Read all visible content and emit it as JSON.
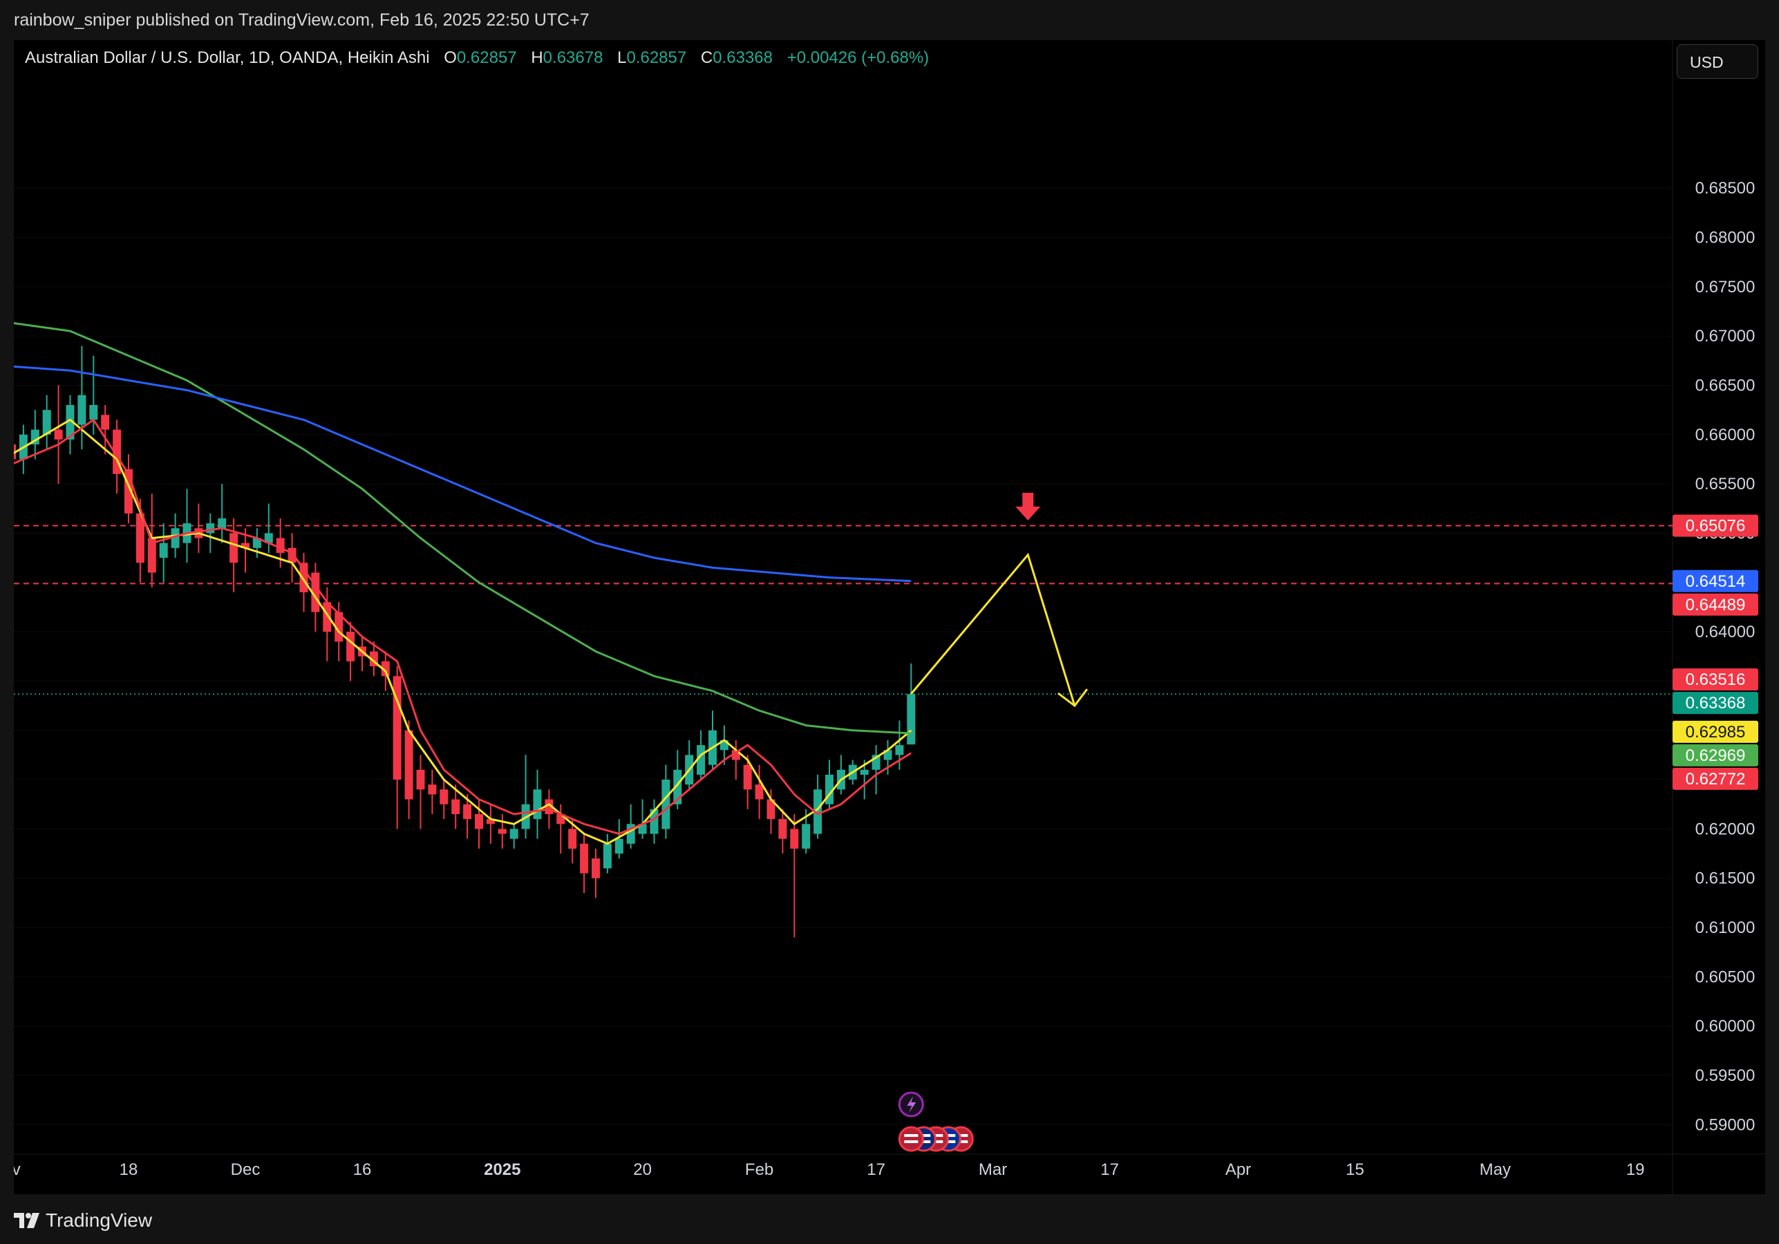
{
  "header": {
    "published_text": "rainbow_sniper published on TradingView.com, Feb 16, 2025 22:50 UTC+7"
  },
  "legend": {
    "symbol": "Australian Dollar / U.S. Dollar, 1D, OANDA, Heikin Ashi",
    "o_label": "O",
    "o_value": "0.62857",
    "h_label": "H",
    "h_value": "0.63678",
    "l_label": "L",
    "l_value": "0.62857",
    "c_label": "C",
    "c_value": "0.63368",
    "change": "+0.00426 (+0.68%)"
  },
  "currency_button": "USD",
  "footer": {
    "brand": "TradingView"
  },
  "colors": {
    "background": "#000000",
    "up": "#22ab94",
    "down": "#f23645",
    "ema_fast": "#f7e52b",
    "ema_mid": "#f23645",
    "ma_green": "#4caf50",
    "ma_blue": "#2962ff",
    "projection": "#f7e52b",
    "level_line": "#f23645",
    "current_line": "#22ab94"
  },
  "chart_data": {
    "type": "candlestick",
    "style": "Heikin Ashi",
    "ylim": [
      0.5875,
      0.6895
    ],
    "y_ticks": [
      "0.68500",
      "0.68000",
      "0.67500",
      "0.67000",
      "0.66500",
      "0.66000",
      "0.65500",
      "0.65000",
      "0.64500",
      "0.64000",
      "0.63500",
      "0.63000",
      "0.62500",
      "0.62000",
      "0.61500",
      "0.61000",
      "0.60500",
      "0.60000",
      "0.59500",
      "0.59000"
    ],
    "x_ticks": [
      {
        "label": "ov",
        "bold": false,
        "bar": 0
      },
      {
        "label": "18",
        "bold": false,
        "bar": 10
      },
      {
        "label": "Dec",
        "bold": false,
        "bar": 20
      },
      {
        "label": "16",
        "bold": false,
        "bar": 30
      },
      {
        "label": "2025",
        "bold": true,
        "bar": 42
      },
      {
        "label": "20",
        "bold": false,
        "bar": 54
      },
      {
        "label": "Feb",
        "bold": false,
        "bar": 64
      },
      {
        "label": "17",
        "bold": false,
        "bar": 74
      },
      {
        "label": "Mar",
        "bold": false,
        "bar": 84
      },
      {
        "label": "17",
        "bold": false,
        "bar": 94
      },
      {
        "label": "Apr",
        "bold": false,
        "bar": 105
      },
      {
        "label": "15",
        "bold": false,
        "bar": 115
      },
      {
        "label": "May",
        "bold": false,
        "bar": 127
      },
      {
        "label": "19",
        "bold": false,
        "bar": 139
      }
    ],
    "candles": [
      [
        0.659,
        0.6605,
        0.656,
        0.6575
      ],
      [
        0.6575,
        0.661,
        0.656,
        0.66
      ],
      [
        0.659,
        0.6625,
        0.6575,
        0.6605
      ],
      [
        0.66,
        0.664,
        0.6585,
        0.6625
      ],
      [
        0.6605,
        0.665,
        0.655,
        0.6595
      ],
      [
        0.6595,
        0.664,
        0.658,
        0.663
      ],
      [
        0.661,
        0.669,
        0.6585,
        0.664
      ],
      [
        0.6615,
        0.668,
        0.66,
        0.663
      ],
      [
        0.662,
        0.663,
        0.658,
        0.6605
      ],
      [
        0.6605,
        0.6615,
        0.654,
        0.656
      ],
      [
        0.6565,
        0.658,
        0.651,
        0.652
      ],
      [
        0.652,
        0.6535,
        0.645,
        0.647
      ],
      [
        0.6495,
        0.654,
        0.6445,
        0.646
      ],
      [
        0.6475,
        0.651,
        0.645,
        0.649
      ],
      [
        0.6485,
        0.652,
        0.6475,
        0.6505
      ],
      [
        0.649,
        0.6545,
        0.647,
        0.651
      ],
      [
        0.6505,
        0.653,
        0.648,
        0.6495
      ],
      [
        0.65,
        0.652,
        0.648,
        0.651
      ],
      [
        0.6505,
        0.655,
        0.649,
        0.6515
      ],
      [
        0.65,
        0.6515,
        0.644,
        0.647
      ],
      [
        0.649,
        0.6505,
        0.646,
        0.6485
      ],
      [
        0.6485,
        0.6505,
        0.6475,
        0.6495
      ],
      [
        0.649,
        0.653,
        0.648,
        0.65
      ],
      [
        0.6495,
        0.6515,
        0.6465,
        0.648
      ],
      [
        0.6485,
        0.65,
        0.645,
        0.647
      ],
      [
        0.647,
        0.648,
        0.642,
        0.644
      ],
      [
        0.646,
        0.647,
        0.64,
        0.642
      ],
      [
        0.643,
        0.6445,
        0.637,
        0.64
      ],
      [
        0.642,
        0.643,
        0.637,
        0.639
      ],
      [
        0.64,
        0.641,
        0.635,
        0.637
      ],
      [
        0.6385,
        0.6395,
        0.636,
        0.6375
      ],
      [
        0.638,
        0.639,
        0.6355,
        0.6365
      ],
      [
        0.637,
        0.638,
        0.634,
        0.6355
      ],
      [
        0.6355,
        0.6365,
        0.62,
        0.625
      ],
      [
        0.63,
        0.631,
        0.621,
        0.623
      ],
      [
        0.626,
        0.6275,
        0.62,
        0.624
      ],
      [
        0.6245,
        0.626,
        0.6215,
        0.6235
      ],
      [
        0.624,
        0.625,
        0.621,
        0.6225
      ],
      [
        0.623,
        0.6245,
        0.62,
        0.6215
      ],
      [
        0.6225,
        0.6235,
        0.619,
        0.621
      ],
      [
        0.6215,
        0.623,
        0.618,
        0.62
      ],
      [
        0.621,
        0.6225,
        0.6185,
        0.6205
      ],
      [
        0.62,
        0.6215,
        0.618,
        0.6195
      ],
      [
        0.619,
        0.6205,
        0.618,
        0.62
      ],
      [
        0.62,
        0.6275,
        0.619,
        0.6225
      ],
      [
        0.621,
        0.626,
        0.619,
        0.624
      ],
      [
        0.623,
        0.624,
        0.62,
        0.6215
      ],
      [
        0.6215,
        0.6225,
        0.6175,
        0.6205
      ],
      [
        0.62,
        0.621,
        0.6165,
        0.618
      ],
      [
        0.6185,
        0.6195,
        0.6135,
        0.6155
      ],
      [
        0.617,
        0.618,
        0.613,
        0.615
      ],
      [
        0.616,
        0.6195,
        0.6155,
        0.6185
      ],
      [
        0.6175,
        0.621,
        0.617,
        0.619
      ],
      [
        0.6185,
        0.6225,
        0.618,
        0.6205
      ],
      [
        0.6195,
        0.623,
        0.619,
        0.6205
      ],
      [
        0.6195,
        0.623,
        0.6185,
        0.622
      ],
      [
        0.62,
        0.6265,
        0.619,
        0.625
      ],
      [
        0.6225,
        0.628,
        0.622,
        0.626
      ],
      [
        0.6245,
        0.629,
        0.624,
        0.6275
      ],
      [
        0.6255,
        0.63,
        0.625,
        0.6285
      ],
      [
        0.6265,
        0.632,
        0.626,
        0.63
      ],
      [
        0.628,
        0.6305,
        0.6265,
        0.629
      ],
      [
        0.628,
        0.629,
        0.625,
        0.627
      ],
      [
        0.6265,
        0.6275,
        0.622,
        0.624
      ],
      [
        0.6245,
        0.6265,
        0.621,
        0.623
      ],
      [
        0.623,
        0.624,
        0.6195,
        0.621
      ],
      [
        0.621,
        0.622,
        0.6175,
        0.619
      ],
      [
        0.62,
        0.6215,
        0.609,
        0.618
      ],
      [
        0.618,
        0.622,
        0.6175,
        0.6205
      ],
      [
        0.6195,
        0.6255,
        0.619,
        0.624
      ],
      [
        0.6225,
        0.627,
        0.622,
        0.6255
      ],
      [
        0.624,
        0.6275,
        0.6235,
        0.626
      ],
      [
        0.625,
        0.627,
        0.6245,
        0.6265
      ],
      [
        0.6255,
        0.627,
        0.623,
        0.626
      ],
      [
        0.626,
        0.6285,
        0.6235,
        0.6275
      ],
      [
        0.627,
        0.629,
        0.6255,
        0.628
      ],
      [
        0.6275,
        0.631,
        0.626,
        0.6285
      ],
      [
        0.62857,
        0.63678,
        0.62857,
        0.63368
      ]
    ],
    "series": [
      {
        "color": "#f7e52b",
        "width": 3,
        "points": [
          [
            0,
            0.658
          ],
          [
            5,
            0.6615
          ],
          [
            9,
            0.6575
          ],
          [
            12,
            0.6495
          ],
          [
            16,
            0.65
          ],
          [
            20,
            0.6485
          ],
          [
            24,
            0.647
          ],
          [
            28,
            0.64
          ],
          [
            32,
            0.636
          ],
          [
            34,
            0.63
          ],
          [
            37,
            0.625
          ],
          [
            41,
            0.621
          ],
          [
            43,
            0.6205
          ],
          [
            46,
            0.6225
          ],
          [
            49,
            0.6195
          ],
          [
            51,
            0.6185
          ],
          [
            54,
            0.6205
          ],
          [
            57,
            0.6245
          ],
          [
            59,
            0.6275
          ],
          [
            61,
            0.629
          ],
          [
            63,
            0.627
          ],
          [
            65,
            0.623
          ],
          [
            67,
            0.6205
          ],
          [
            69,
            0.622
          ],
          [
            71,
            0.625
          ],
          [
            73,
            0.6265
          ],
          [
            75,
            0.628
          ],
          [
            77,
            0.63
          ]
        ]
      },
      {
        "color": "#f23645",
        "width": 3,
        "points": [
          [
            0,
            0.657
          ],
          [
            4,
            0.659
          ],
          [
            7,
            0.6615
          ],
          [
            10,
            0.656
          ],
          [
            12,
            0.649
          ],
          [
            15,
            0.65
          ],
          [
            18,
            0.6505
          ],
          [
            21,
            0.6495
          ],
          [
            24,
            0.648
          ],
          [
            27,
            0.643
          ],
          [
            30,
            0.6395
          ],
          [
            33,
            0.637
          ],
          [
            35,
            0.63
          ],
          [
            37,
            0.626
          ],
          [
            40,
            0.623
          ],
          [
            43,
            0.6215
          ],
          [
            46,
            0.622
          ],
          [
            49,
            0.6205
          ],
          [
            52,
            0.6195
          ],
          [
            55,
            0.621
          ],
          [
            58,
            0.624
          ],
          [
            61,
            0.627
          ],
          [
            63,
            0.6285
          ],
          [
            65,
            0.6265
          ],
          [
            67,
            0.6235
          ],
          [
            69,
            0.6215
          ],
          [
            71,
            0.6225
          ],
          [
            74,
            0.6255
          ],
          [
            77,
            0.6277
          ]
        ]
      },
      {
        "color": "#4caf50",
        "width": 3,
        "points": [
          [
            -1,
            0.6715
          ],
          [
            5,
            0.6705
          ],
          [
            10,
            0.668
          ],
          [
            15,
            0.6655
          ],
          [
            20,
            0.662
          ],
          [
            25,
            0.6585
          ],
          [
            30,
            0.6545
          ],
          [
            35,
            0.6495
          ],
          [
            40,
            0.645
          ],
          [
            45,
            0.6415
          ],
          [
            50,
            0.638
          ],
          [
            55,
            0.6355
          ],
          [
            60,
            0.634
          ],
          [
            64,
            0.632
          ],
          [
            68,
            0.6305
          ],
          [
            72,
            0.63
          ],
          [
            77,
            0.6297
          ]
        ]
      },
      {
        "color": "#2962ff",
        "width": 3,
        "points": [
          [
            -1,
            0.667
          ],
          [
            5,
            0.6665
          ],
          [
            10,
            0.6655
          ],
          [
            15,
            0.6645
          ],
          [
            20,
            0.663
          ],
          [
            25,
            0.6615
          ],
          [
            30,
            0.659
          ],
          [
            35,
            0.6565
          ],
          [
            40,
            0.654
          ],
          [
            45,
            0.6515
          ],
          [
            50,
            0.649
          ],
          [
            55,
            0.6475
          ],
          [
            60,
            0.6465
          ],
          [
            65,
            0.646
          ],
          [
            70,
            0.6455
          ],
          [
            74,
            0.6453
          ],
          [
            77,
            0.64514
          ]
        ]
      }
    ],
    "levels": [
      {
        "price": 0.65076,
        "label": "0.65076",
        "color": "#f23645"
      },
      {
        "price": 0.64489,
        "label": "0.64489",
        "color": "#f23645"
      }
    ],
    "current_price": {
      "price": 0.63368,
      "label": "0.63368",
      "color": "#089981"
    },
    "price_tags": [
      {
        "price": 0.65076,
        "label": "0.65076",
        "bg": "#f23645",
        "fg": "#ffffff"
      },
      {
        "price": 0.64514,
        "label": "0.64514",
        "bg": "#2962ff",
        "fg": "#ffffff"
      },
      {
        "price": 0.64489,
        "label": "0.64489",
        "bg": "#f23645",
        "fg": "#ffffff"
      },
      {
        "price": 0.63516,
        "label": "0.63516",
        "bg": "#f23645",
        "fg": "#ffffff"
      },
      {
        "price": 0.63368,
        "label": "0.63368",
        "bg": "#089981",
        "fg": "#ffffff"
      },
      {
        "price": 0.62985,
        "label": "0.62985",
        "bg": "#f7e52b",
        "fg": "#131313"
      },
      {
        "price": 0.62969,
        "label": "0.62969",
        "bg": "#4caf50",
        "fg": "#ffffff"
      },
      {
        "price": 0.62772,
        "label": "0.62772",
        "bg": "#f23645",
        "fg": "#ffffff"
      }
    ],
    "projection": [
      [
        77,
        0.6337
      ],
      [
        87,
        0.6478
      ],
      [
        91,
        0.6325
      ]
    ],
    "sell_arrow": {
      "bar": 87,
      "price": 0.6527
    },
    "event_icons": [
      "lightning-icon",
      "us-flag-icon",
      "au-flag-icon",
      "us-flag-icon",
      "eu-flag-icon",
      "us-flag-icon"
    ]
  }
}
